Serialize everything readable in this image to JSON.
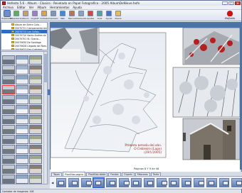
{
  "window": {
    "title": "Hefesto 5.6 - Album - Clasico - Revelado en Papel Fotografico - 2005 AlbumDeNieve.hefe",
    "controls": [
      "_",
      "□",
      "✕"
    ]
  },
  "menu": [
    "Archivo",
    "Editar",
    "Ver",
    "Album",
    "Herramientas",
    "Ayuda"
  ],
  "toolbar": [
    {
      "label": "Explorador",
      "icon": "explorer-icon",
      "color": "#6d8fc7"
    },
    {
      "label": "Presentacion",
      "icon": "presentation-icon",
      "color": "#5fae5a"
    },
    {
      "label": "Album",
      "icon": "album-icon",
      "color": "#c2a36a"
    },
    {
      "label": "ImgSoft",
      "icon": "image-edit-icon",
      "color": "#9a7fc1"
    },
    {
      "label": "Carteles",
      "icon": "poster-icon",
      "color": "#d9a642"
    },
    {
      "label": "Impresion",
      "icon": "print-icon",
      "color": "#7f95b1"
    },
    {
      "label": "Web",
      "icon": "web-icon",
      "color": "#3f8ad6"
    },
    {
      "label": "Marcos",
      "icon": "frame-icon",
      "color": "#b07a4a"
    },
    {
      "label": "Previsualiz.",
      "icon": "preview-icon",
      "color": "#8aa0c0"
    },
    {
      "label": "Ajustes",
      "icon": "settings-icon",
      "color": "#c94a4a"
    },
    {
      "label": "Guia",
      "icon": "guide-icon",
      "color": "#5aa0a0"
    },
    {
      "label": "Ayuda",
      "icon": "help-icon",
      "color": "#4a72c4"
    },
    {
      "label": "Nueva",
      "icon": "new-icon",
      "color": "#e0c050"
    }
  ],
  "logo": {
    "text": "Hefesto"
  },
  "folders": [
    "Album de Sierra Cala...",
    "20070721 Campamento reno...",
    "20070715 Los Caños...",
    "20070710 Santo Andres de T...",
    "20070701 St. Gracia...",
    "20070630 De Santiago",
    "20070628 Llegada del Ram...",
    "20070627 San Cristobal",
    "20070620 Carmen Virgen",
    "20070618 Buenos dias"
  ],
  "selected_folder_index": 2,
  "thumbnail_count": 42,
  "selected_thumb_index": 9,
  "caption": {
    "line1": "Primera nevada del año.",
    "line2": "O Cebreiro (Lugo) (29/1/2005)"
  },
  "page_indicator": "Páginas 8 Y 9 de 48",
  "tabs": [
    "Tapas",
    "Plantillas pagina",
    "Plantillas doble",
    "Fondos",
    "Cliparts",
    "Máscaras",
    "Texto"
  ],
  "active_tab": 1,
  "layout_count": 15,
  "selected_layout": 3,
  "status": "Contador de imagenes: 108"
}
